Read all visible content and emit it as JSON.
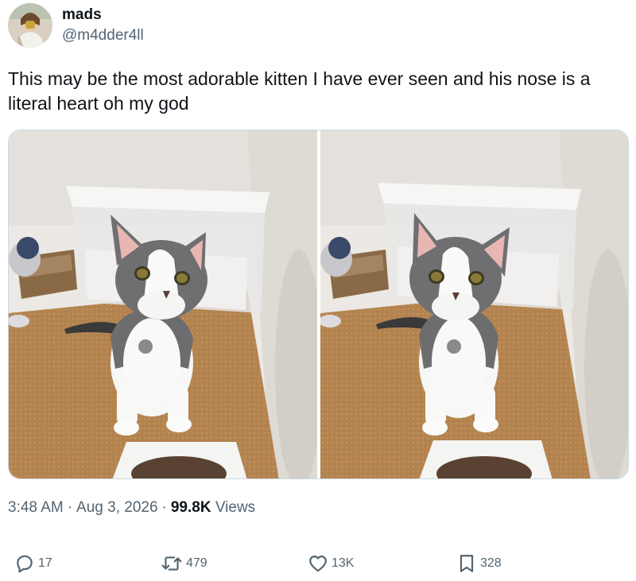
{
  "tweet": {
    "display_name": "mads",
    "handle": "@m4dder4ll",
    "text": "This may be the most adorable kitten I have ever seen and his nose is a literal heart oh my god",
    "time": "3:48 AM",
    "date": "Aug 3, 2026",
    "views_count": "99.8K",
    "views_label": "Views",
    "separator": "·"
  },
  "media": {
    "photos": [
      {
        "subject": "kitten-photo-1"
      },
      {
        "subject": "kitten-photo-2"
      }
    ]
  },
  "actions": {
    "replies": "17",
    "reposts": "479",
    "likes": "13K",
    "bookmarks": "328"
  },
  "colors": {
    "text_primary": "#0f1419",
    "text_secondary": "#536471",
    "border": "#cfd9de"
  },
  "icons": [
    "reply-icon",
    "repost-icon",
    "like-icon",
    "bookmark-icon"
  ]
}
